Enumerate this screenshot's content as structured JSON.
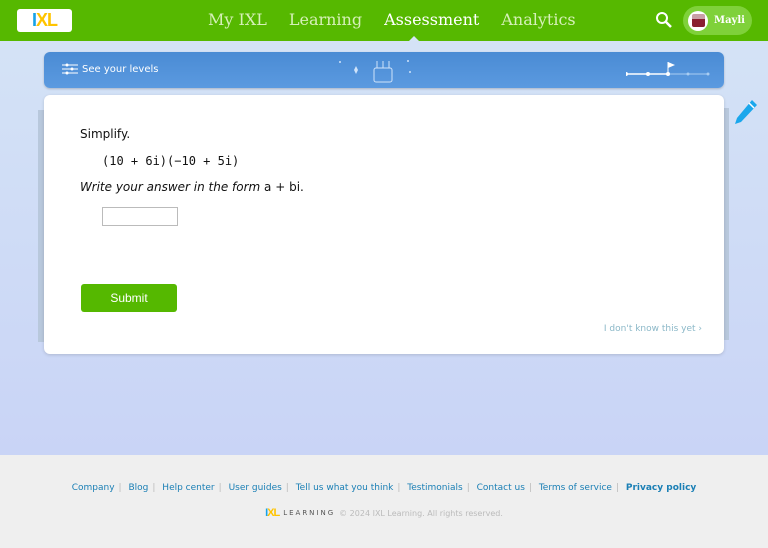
{
  "nav": {
    "logo": "IXL",
    "links": [
      {
        "label": "My IXL"
      },
      {
        "label": "Learning"
      },
      {
        "label": "Assessment",
        "active": true
      },
      {
        "label": "Analytics"
      }
    ],
    "user_name": "Mayli"
  },
  "banner": {
    "label": "See your levels"
  },
  "question": {
    "instruction": "Simplify.",
    "expression": "(10 + 6i)(−10 + 5i)",
    "form_prefix": "Write your answer in the form ",
    "form": "a + bi.",
    "answer_value": "",
    "submit_label": "Submit",
    "idk_label": "I don't know this yet ›"
  },
  "footer": {
    "links": [
      "Company",
      "Blog",
      "Help center",
      "User guides",
      "Tell us what you think",
      "Testimonials",
      "Contact us",
      "Terms of service",
      "Privacy policy"
    ],
    "logo": "IXL",
    "logo_sub": "LEARNING",
    "copyright": "© 2024 IXL Learning. All rights reserved."
  },
  "colors": {
    "nav": "#56b800",
    "accent": "#17a2e8",
    "link": "#1a7fb5"
  }
}
